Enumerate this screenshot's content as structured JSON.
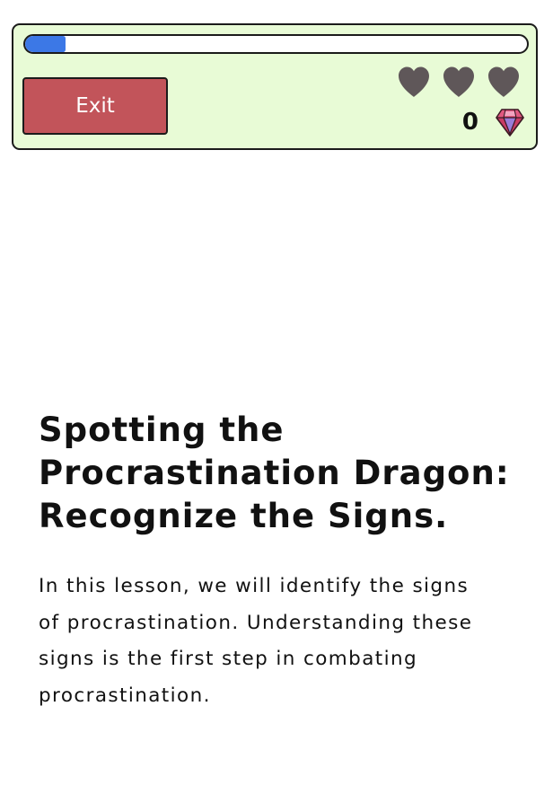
{
  "header": {
    "progress": 0.08,
    "progress_color": "#3c78e6",
    "exit_label": "Exit",
    "exit_color": "#c2545a",
    "panel_color": "#e8fbd6",
    "hearts": [
      "heart-icon",
      "heart-icon",
      "heart-icon"
    ],
    "heart_color": "#5f5759",
    "gem_count": "0",
    "gem_icon": "gem-icon"
  },
  "lesson": {
    "title": "Spotting the Procrastination Dragon: Recognize the Signs.",
    "body": "In this lesson, we will identify the signs of procrastination. Understanding these signs is the first step in combating procrastination."
  }
}
